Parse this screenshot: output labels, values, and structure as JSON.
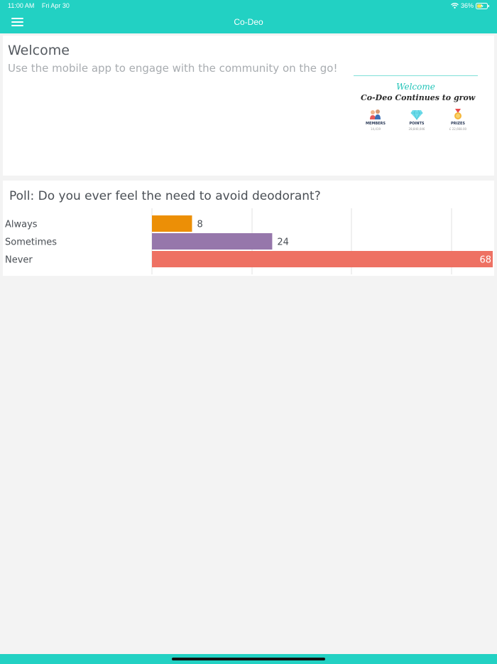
{
  "status_bar": {
    "time": "11:00 AM",
    "date": "Fri Apr 30",
    "battery": "36%",
    "wifi_icon": "wifi-icon",
    "battery_icon": "battery-charging-icon"
  },
  "app_bar": {
    "title": "Co-Deo",
    "menu_icon": "hamburger-menu-icon",
    "color": "#22d1c3"
  },
  "welcome": {
    "title": "Welcome",
    "subtitle": "Use the mobile app to engage with the community on the go!",
    "banner": {
      "heading": "Welcome",
      "tagline": "Co-Deo Continues to grow",
      "stats": [
        {
          "label": "MEMBERS",
          "value": "14,419",
          "icon": "people-icon"
        },
        {
          "label": "POINTS",
          "value": "28,840,046",
          "icon": "diamond-icon"
        },
        {
          "label": "PRIZES",
          "value": "£ 22,668.00",
          "icon": "medal-icon"
        }
      ]
    }
  },
  "poll": {
    "title": "Poll: Do you ever feel the need to avoid deodorant?"
  },
  "chart_data": {
    "type": "bar",
    "orientation": "horizontal",
    "categories": [
      "Always",
      "Sometimes",
      "Never"
    ],
    "values": [
      8,
      24,
      68
    ],
    "colors": [
      "#ec8f06",
      "#9677ab",
      "#ee7163"
    ],
    "xlim": [
      0,
      68
    ],
    "grid": true
  }
}
